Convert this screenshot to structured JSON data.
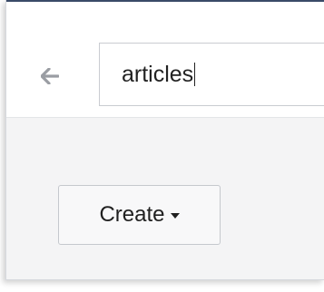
{
  "search": {
    "value": "articles"
  },
  "toolbar": {
    "create_label": "Create"
  },
  "icons": {
    "back": "arrow-left-icon",
    "dropdown": "caret-down-icon"
  },
  "colors": {
    "top_bar": "#3a4a68",
    "content_background": "#f4f4f5",
    "back_arrow": "#9a9da3"
  }
}
